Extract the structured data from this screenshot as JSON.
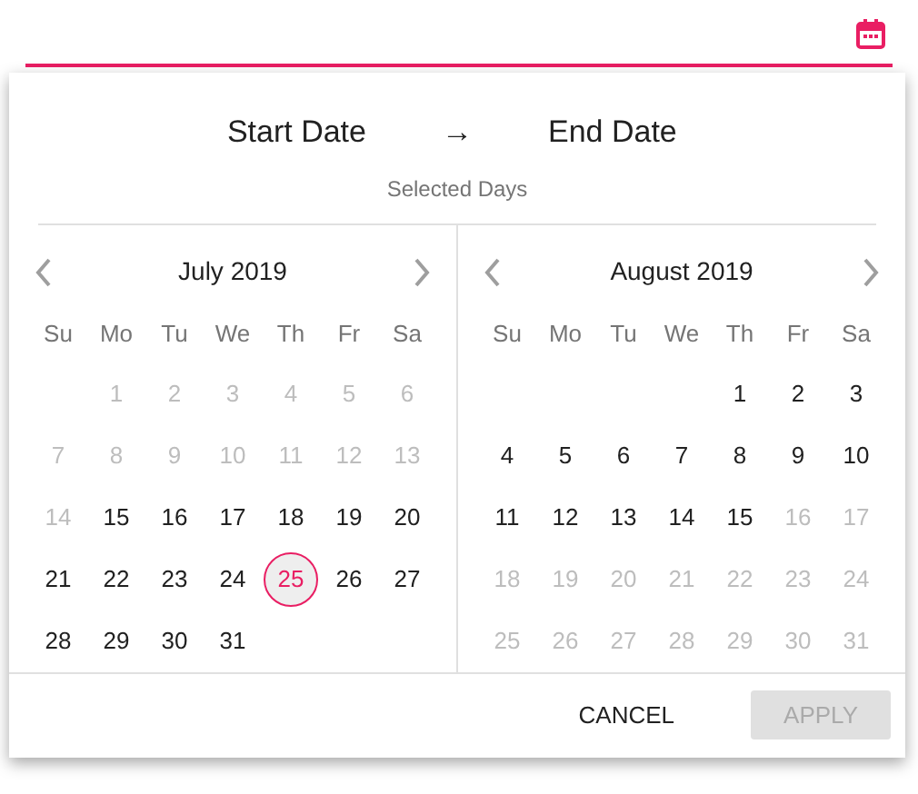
{
  "range_header": {
    "start": "Start Date",
    "arrow": "→",
    "end": "End Date",
    "caption": "Selected Days"
  },
  "calendars": [
    {
      "title": "July 2019",
      "weekdays": [
        "Su",
        "Mo",
        "Tu",
        "We",
        "Th",
        "Fr",
        "Sa"
      ],
      "weeks": [
        [
          {
            "text": "1",
            "disabled": true,
            "selected": false
          },
          {
            "text": "2",
            "disabled": true,
            "selected": false
          },
          {
            "text": "3",
            "disabled": true,
            "selected": false
          },
          {
            "text": "4",
            "disabled": true,
            "selected": false
          },
          {
            "text": "5",
            "disabled": true,
            "selected": false
          },
          {
            "text": "6",
            "disabled": true,
            "selected": false
          }
        ],
        [
          {
            "text": "7",
            "disabled": true,
            "selected": false
          },
          {
            "text": "8",
            "disabled": true,
            "selected": false
          },
          {
            "text": "9",
            "disabled": true,
            "selected": false
          },
          {
            "text": "10",
            "disabled": true,
            "selected": false
          },
          {
            "text": "11",
            "disabled": true,
            "selected": false
          },
          {
            "text": "12",
            "disabled": true,
            "selected": false
          },
          {
            "text": "13",
            "disabled": true,
            "selected": false
          }
        ],
        [
          {
            "text": "14",
            "disabled": true,
            "selected": false
          },
          {
            "text": "15",
            "disabled": false,
            "selected": false
          },
          {
            "text": "16",
            "disabled": false,
            "selected": false
          },
          {
            "text": "17",
            "disabled": false,
            "selected": false
          },
          {
            "text": "18",
            "disabled": false,
            "selected": false
          },
          {
            "text": "19",
            "disabled": false,
            "selected": false
          },
          {
            "text": "20",
            "disabled": false,
            "selected": false
          }
        ],
        [
          {
            "text": "21",
            "disabled": false,
            "selected": false
          },
          {
            "text": "22",
            "disabled": false,
            "selected": false
          },
          {
            "text": "23",
            "disabled": false,
            "selected": false
          },
          {
            "text": "24",
            "disabled": false,
            "selected": false
          },
          {
            "text": "25",
            "disabled": false,
            "selected": true
          },
          {
            "text": "26",
            "disabled": false,
            "selected": false
          },
          {
            "text": "27",
            "disabled": false,
            "selected": false
          }
        ],
        [
          {
            "text": "28",
            "disabled": false,
            "selected": false
          },
          {
            "text": "29",
            "disabled": false,
            "selected": false
          },
          {
            "text": "30",
            "disabled": false,
            "selected": false
          },
          {
            "text": "31",
            "disabled": false,
            "selected": false
          }
        ]
      ]
    },
    {
      "title": "August 2019",
      "weekdays": [
        "Su",
        "Mo",
        "Tu",
        "We",
        "Th",
        "Fr",
        "Sa"
      ],
      "weeks": [
        [
          {
            "text": "1",
            "disabled": false,
            "selected": false
          },
          {
            "text": "2",
            "disabled": false,
            "selected": false
          },
          {
            "text": "3",
            "disabled": false,
            "selected": false
          }
        ],
        [
          {
            "text": "4",
            "disabled": false,
            "selected": false
          },
          {
            "text": "5",
            "disabled": false,
            "selected": false
          },
          {
            "text": "6",
            "disabled": false,
            "selected": false
          },
          {
            "text": "7",
            "disabled": false,
            "selected": false
          },
          {
            "text": "8",
            "disabled": false,
            "selected": false
          },
          {
            "text": "9",
            "disabled": false,
            "selected": false
          },
          {
            "text": "10",
            "disabled": false,
            "selected": false
          }
        ],
        [
          {
            "text": "11",
            "disabled": false,
            "selected": false
          },
          {
            "text": "12",
            "disabled": false,
            "selected": false
          },
          {
            "text": "13",
            "disabled": false,
            "selected": false
          },
          {
            "text": "14",
            "disabled": false,
            "selected": false
          },
          {
            "text": "15",
            "disabled": false,
            "selected": false
          },
          {
            "text": "16",
            "disabled": true,
            "selected": false
          },
          {
            "text": "17",
            "disabled": true,
            "selected": false
          }
        ],
        [
          {
            "text": "18",
            "disabled": true,
            "selected": false
          },
          {
            "text": "19",
            "disabled": true,
            "selected": false
          },
          {
            "text": "20",
            "disabled": true,
            "selected": false
          },
          {
            "text": "21",
            "disabled": true,
            "selected": false
          },
          {
            "text": "22",
            "disabled": true,
            "selected": false
          },
          {
            "text": "23",
            "disabled": true,
            "selected": false
          },
          {
            "text": "24",
            "disabled": true,
            "selected": false
          }
        ],
        [
          {
            "text": "25",
            "disabled": true,
            "selected": false
          },
          {
            "text": "26",
            "disabled": true,
            "selected": false
          },
          {
            "text": "27",
            "disabled": true,
            "selected": false
          },
          {
            "text": "28",
            "disabled": true,
            "selected": false
          },
          {
            "text": "29",
            "disabled": true,
            "selected": false
          },
          {
            "text": "30",
            "disabled": true,
            "selected": false
          },
          {
            "text": "31",
            "disabled": true,
            "selected": false
          }
        ]
      ]
    }
  ],
  "buttons": [
    {
      "label": "CANCEL",
      "disabled": false
    },
    {
      "label": "APPLY",
      "disabled": true
    }
  ]
}
